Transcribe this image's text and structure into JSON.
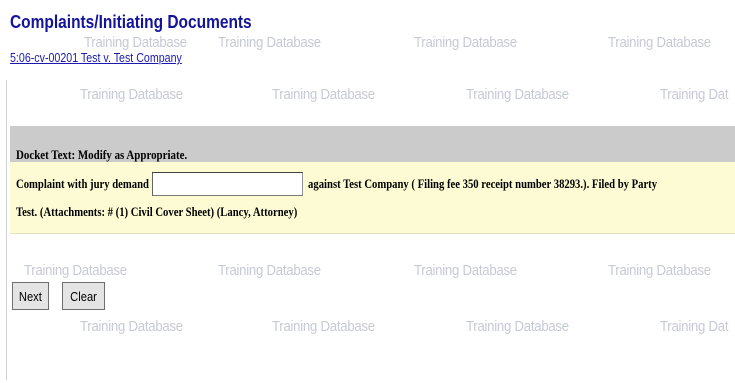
{
  "page": {
    "title": "Complaints/Initiating Documents",
    "case_link": "5:06-cv-00201 Test v. Test Company"
  },
  "watermark": {
    "text": "Training Database",
    "rows": [
      [
        "Training Database",
        "Training Database",
        "Training Database",
        "Training Database"
      ],
      [
        "Training Database",
        "Training Database",
        "Training Database",
        "Training Dat"
      ],
      [
        "Training Database",
        "Training Database",
        "Training Database",
        "Training Database"
      ],
      [
        "Training Database",
        "Training Database",
        "Training Database",
        "Training Dat"
      ]
    ]
  },
  "docket": {
    "header": "Docket Text: Modify as Appropriate.",
    "prefix": "Complaint with jury demand",
    "input_value": "",
    "suffix": "against Test Company ( Filing fee 350 receipt number 38293.). Filed by Party",
    "line2": "Test. (Attachments: # (1) Civil Cover Sheet) (Lancy, Attorney)"
  },
  "buttons": {
    "next": "Next",
    "clear": "Clear"
  },
  "colors": {
    "title": "#14149a",
    "link": "#1a1ab0",
    "header_bg": "#cbcbcb",
    "body_bg": "#fdfbd3",
    "watermark": "#c6cad6"
  }
}
